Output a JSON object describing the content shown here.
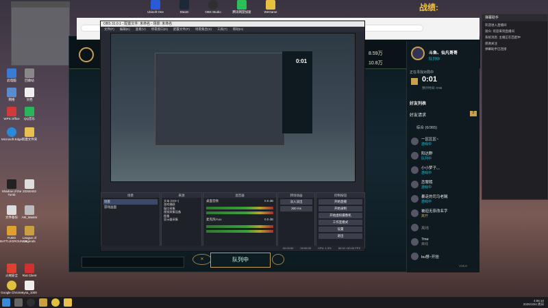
{
  "top_banner": {
    "text": "战绩:"
  },
  "desktop_icons": [
    "此电脑",
    "回收站",
    "网络",
    "文档",
    "WPS Office",
    "QQ音乐",
    "Microsoft Edge",
    "新建文件夹",
    "Shadow of the Tomb",
    "20250402",
    "文件备份",
    "AM_Master",
    "PUBG BATTLEGROUNDS",
    "League of Legends",
    "火绒安全",
    "Riot Client",
    "Google Chrome",
    "sysa_1000"
  ],
  "top_icons": [
    "Ubisoft One",
    "Steam",
    "OBS Studio",
    "腾讯网游加速",
    "WeGame"
  ],
  "obs": {
    "title": "OBS 31.0.1 - 配置文件: 未命名 - 场景: 未命名",
    "menu": [
      "文件(F)",
      "编辑(E)",
      "查看(V)",
      "停靠窗口(D)",
      "配置文件(P)",
      "场景集合(S)",
      "工具(T)",
      "帮助(H)"
    ],
    "docks": {
      "scenes": "场景",
      "sources": "来源",
      "mixer": "混音器",
      "transitions": "转场动画",
      "controls": "控制按钮"
    },
    "scenes": [
      "场景",
      "游戏画面"
    ],
    "sources": [
      "文本 (GDI+)",
      "游戏捕获",
      "窗口采集",
      "视频采集设备",
      "图像",
      "显示器采集"
    ],
    "mixer": [
      {
        "name": "桌面音频",
        "db": "0.0 dB"
      },
      {
        "name": "麦克风/Aux",
        "db": "0.0 dB"
      }
    ],
    "transition": {
      "type": "淡入淡出",
      "duration": "300 ms"
    },
    "controls": [
      "开始直播",
      "开始录制",
      "开始虚拟摄像机",
      "工作室模式",
      "设置",
      "退出"
    ],
    "status": {
      "cpu": "CPU: 1.3%",
      "fps": "60.00 / 60.00 FPS",
      "time1": "00:00:00",
      "time2": "00:00:00"
    }
  },
  "lol": {
    "queue_button": "队列中",
    "stat1": "8.59万",
    "stat2": "10.8万",
    "accent": "#0acbe6"
  },
  "social": {
    "username": "斗鱼、仙凡哥哥",
    "status": "队列中",
    "queue_header": "正在寻找对局中",
    "timer": "0:01",
    "timer_sub": "预计时间: 0:56",
    "friends_title": "好友列表",
    "friend_request": "好友请求",
    "request_count": "2",
    "group": "综合 (6/365)",
    "friends": [
      {
        "name": "一区区区~",
        "status": "游戏中"
      },
      {
        "name": "阳达野",
        "status": "队列中"
      },
      {
        "name": "小小梦子、、",
        "status": "游戏中"
      },
      {
        "name": "恋翠熙",
        "status": "游戏中"
      },
      {
        "name": "暴走的司马老贼",
        "status": "游戏中"
      },
      {
        "name": "被迫无奈改名字",
        "status": "离开"
      },
      {
        "name": "离线",
        "status": ""
      },
      {
        "name": "7me",
        "status": "离线"
      },
      {
        "name": "bu想~开挂",
        "status": ""
      }
    ],
    "version": "V15.6"
  },
  "chat": {
    "title": "弹幕助手",
    "lines": [
      "欢迎进入直播间",
      "观众: 欢迎来到直播间",
      "系统消息: 主播正在匹配中",
      "感谢关注",
      "弹幕助手已连接"
    ]
  },
  "taskbar": {
    "time": "4:06:10",
    "date": "2025/10/4 周日"
  }
}
